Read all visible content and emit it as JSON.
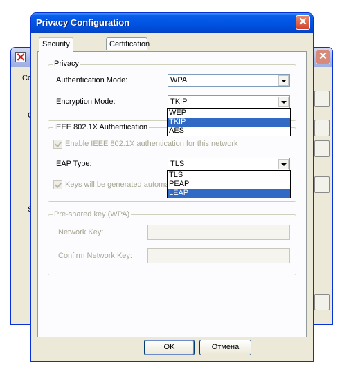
{
  "background_window": {
    "fragments": [
      "Co",
      "C",
      "S"
    ]
  },
  "dialog": {
    "title": "Privacy Configuration",
    "close_glyph": "✕"
  },
  "tabs": [
    {
      "label": "Security",
      "active": true
    },
    {
      "label": "Certification",
      "active": false
    }
  ],
  "privacy": {
    "legend": "Privacy",
    "auth_mode_label": "Authentication Mode:",
    "auth_mode_value": "WPA",
    "encryption_label": "Encryption Mode:",
    "encryption_value": "TKIP",
    "encryption_options": [
      "WEP",
      "TKIP",
      "AES"
    ],
    "encryption_selected": "TKIP"
  },
  "ieee": {
    "legend": "IEEE 802.1X Authentication",
    "enable_label": "Enable IEEE 802.1X authentication for this network",
    "enable_checked": true,
    "eap_label": "EAP Type:",
    "eap_value": "TLS",
    "eap_options": [
      "TLS",
      "PEAP",
      "LEAP"
    ],
    "eap_selected": "LEAP",
    "keys_label": "Keys will be generated automa",
    "keys_checked": true
  },
  "psk": {
    "legend": "Pre-shared key (WPA)",
    "network_key_label": "Network Key:",
    "network_key_value": "",
    "confirm_key_label": "Confirm Network Key:",
    "confirm_key_value": ""
  },
  "buttons": {
    "ok": "OK",
    "cancel": "Отмена"
  },
  "icons": [
    "app-icon",
    "close-icon",
    "dropdown-arrow-icon",
    "checkbox-icon"
  ],
  "colors": {
    "titlebar": "#0054e3",
    "selection": "#316ac5",
    "face": "#ece9d8",
    "close": "#d1432b"
  }
}
